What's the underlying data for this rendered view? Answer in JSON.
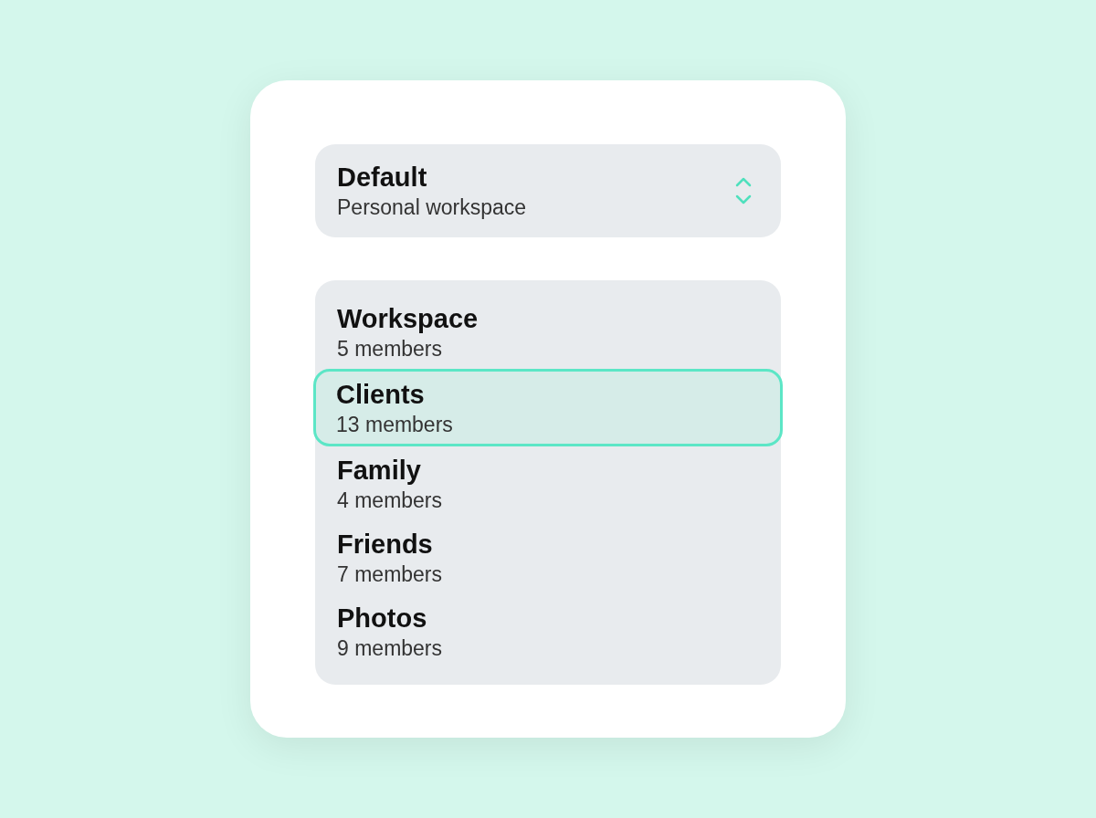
{
  "workspace_selector": {
    "title": "Default",
    "subtitle": "Personal workspace"
  },
  "groups": [
    {
      "name": "Workspace",
      "members": "5 members",
      "selected": false
    },
    {
      "name": "Clients",
      "members": "13 members",
      "selected": true
    },
    {
      "name": "Family",
      "members": "4 members",
      "selected": false
    },
    {
      "name": "Friends",
      "members": "7 members",
      "selected": false
    },
    {
      "name": "Photos",
      "members": "9 members",
      "selected": false
    }
  ]
}
